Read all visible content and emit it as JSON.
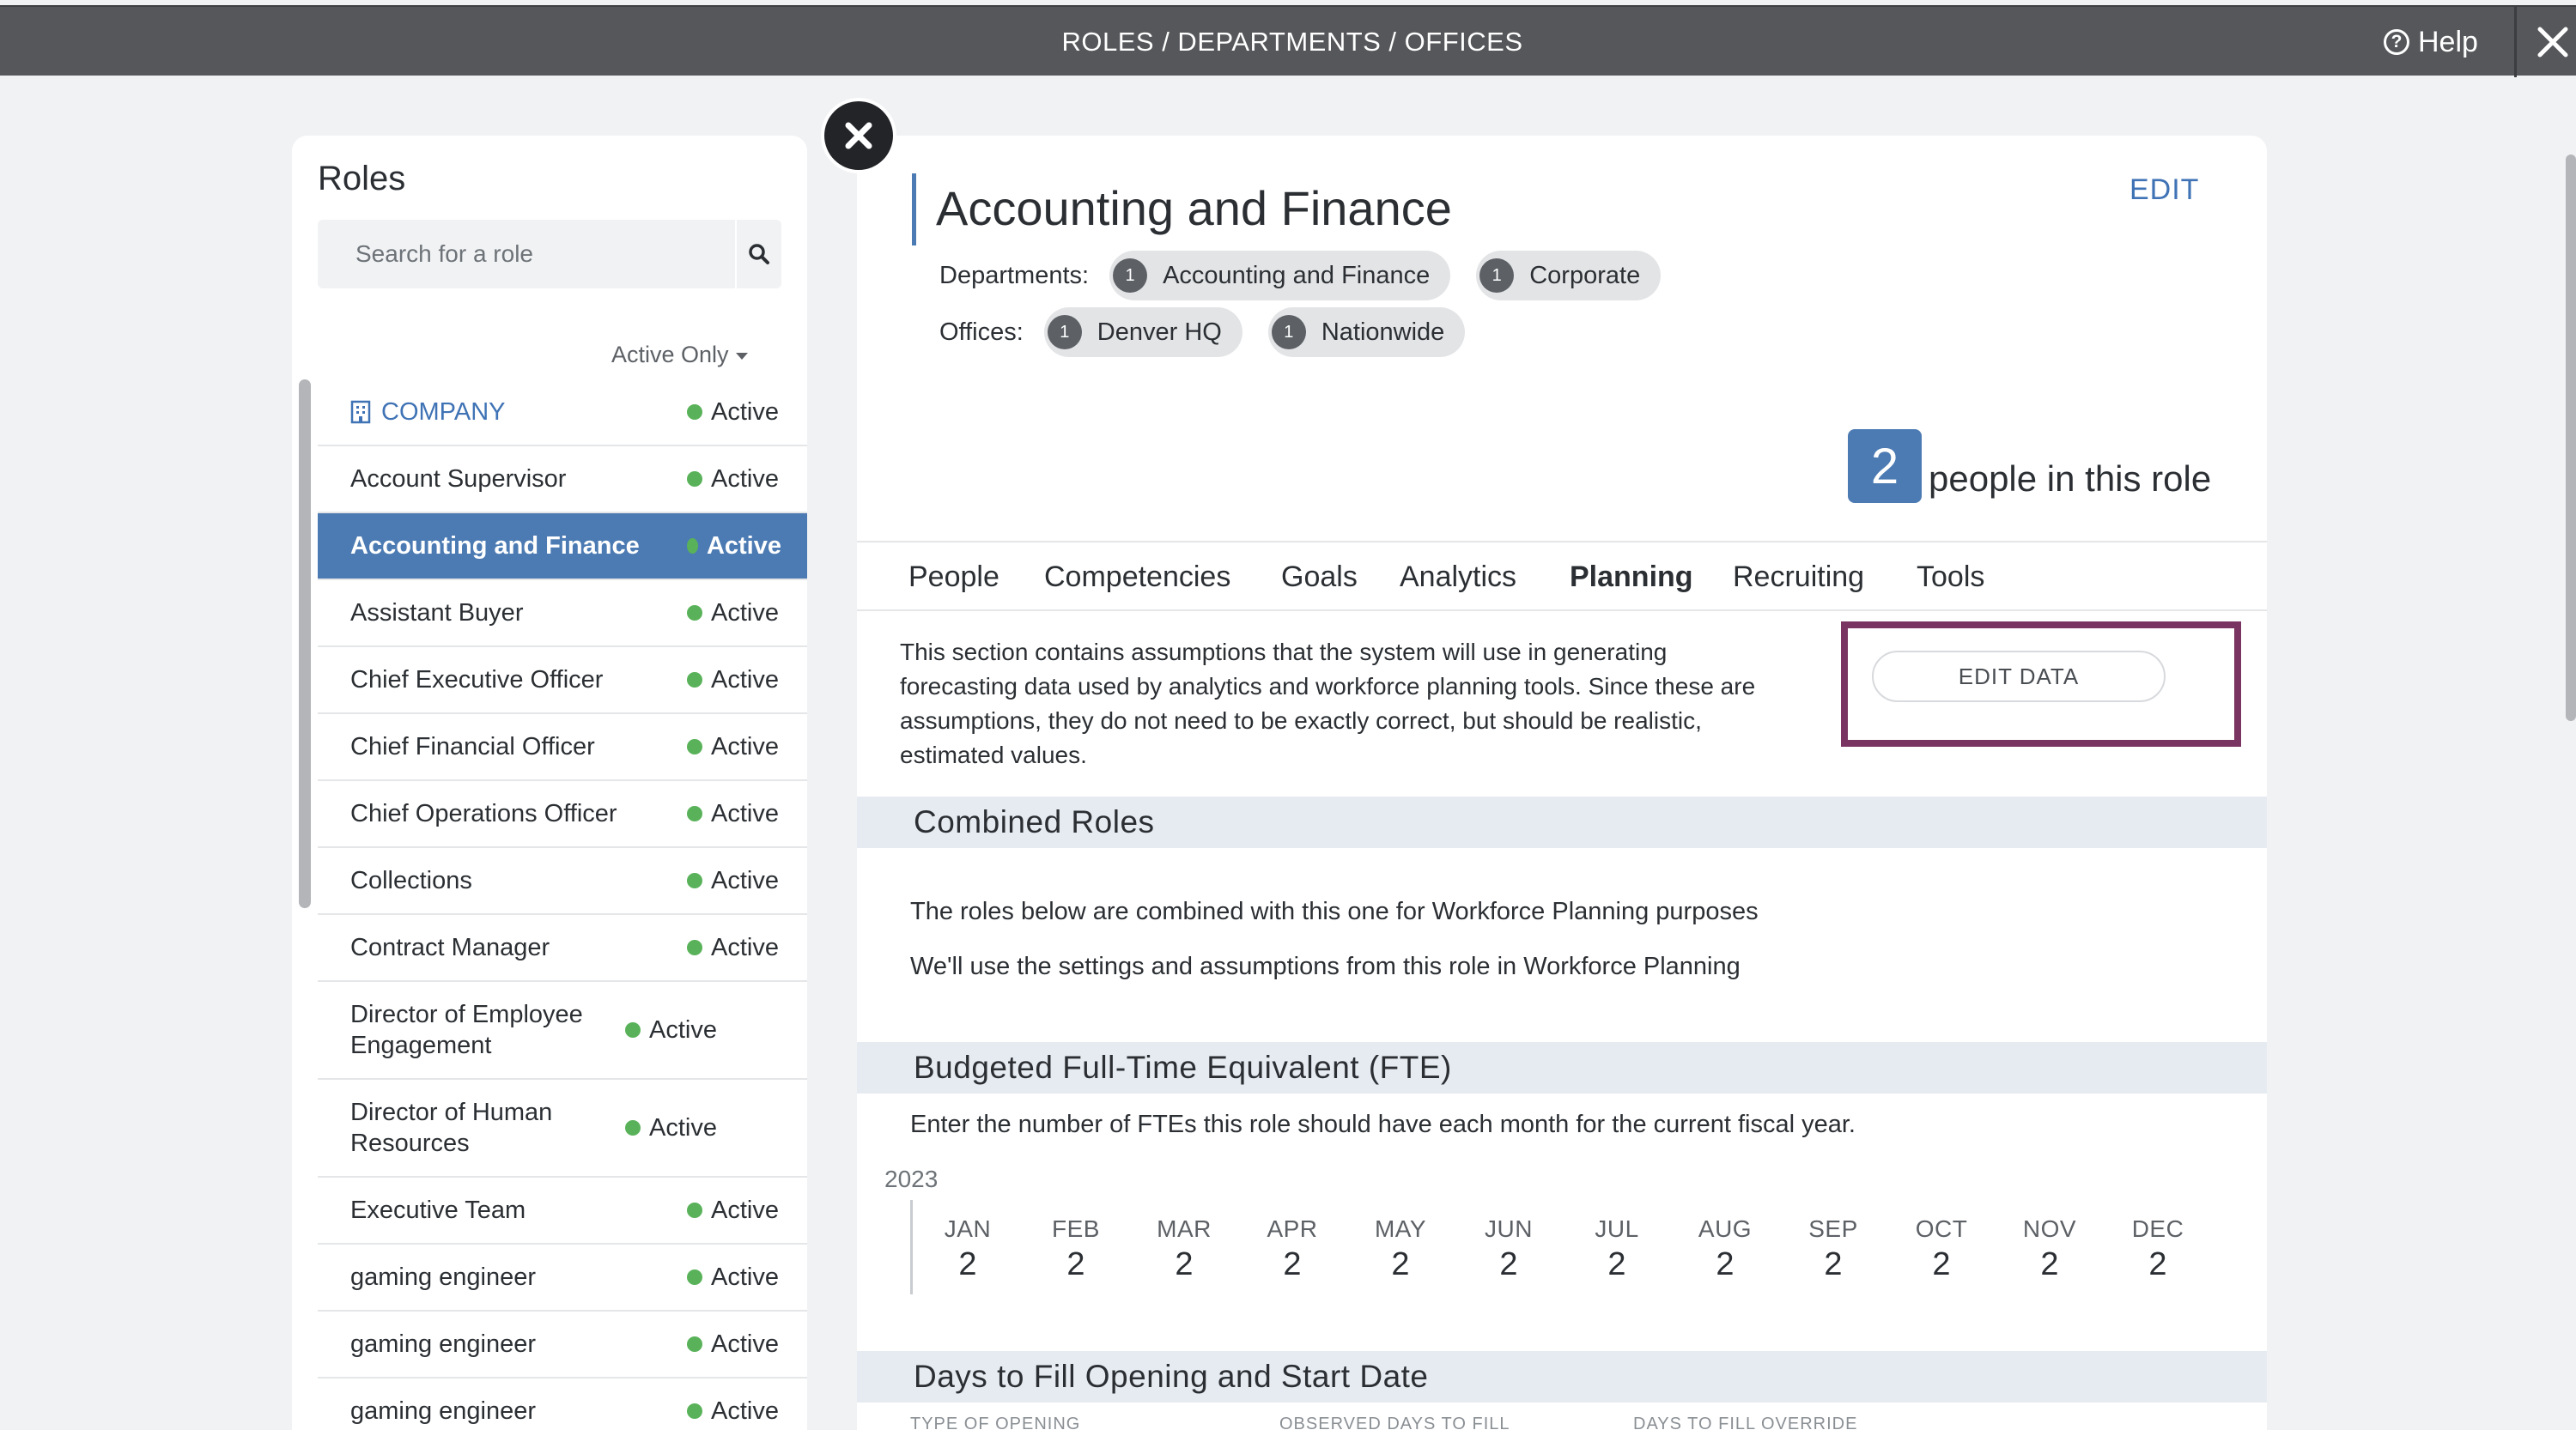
{
  "topbar": {
    "title": "ROLES / DEPARTMENTS / OFFICES",
    "help_label": "Help"
  },
  "sidebar": {
    "title": "Roles",
    "search_placeholder": "Search for a role",
    "filter_label": "Active Only",
    "company": {
      "label": "COMPANY",
      "status": "Active"
    },
    "roles": [
      {
        "name": "Account Supervisor",
        "status": "Active"
      },
      {
        "name": "Accounting and Finance",
        "status": "Active",
        "selected": true
      },
      {
        "name": "Assistant Buyer",
        "status": "Active"
      },
      {
        "name": "Chief Executive Officer",
        "status": "Active"
      },
      {
        "name": "Chief Financial Officer",
        "status": "Active"
      },
      {
        "name": "Chief Operations Officer",
        "status": "Active"
      },
      {
        "name": "Collections",
        "status": "Active"
      },
      {
        "name": "Contract Manager",
        "status": "Active"
      },
      {
        "name": "Director of Employee Engagement",
        "status": "Active"
      },
      {
        "name": "Director of Human Resources",
        "status": "Active"
      },
      {
        "name": "Executive Team",
        "status": "Active"
      },
      {
        "name": "gaming engineer",
        "status": "Active"
      },
      {
        "name": "gaming engineer",
        "status": "Active"
      },
      {
        "name": "gaming engineer",
        "status": "Active"
      }
    ]
  },
  "main": {
    "title": "Accounting and Finance",
    "edit_label": "EDIT",
    "departments_label": "Departments:",
    "departments": [
      {
        "count": "1",
        "name": "Accounting and Finance"
      },
      {
        "count": "1",
        "name": "Corporate"
      }
    ],
    "offices_label": "Offices:",
    "offices": [
      {
        "count": "1",
        "name": "Denver HQ"
      },
      {
        "count": "1",
        "name": "Nationwide"
      }
    ],
    "people_count": "2",
    "people_label": "people in this role",
    "tabs": [
      {
        "label": "People"
      },
      {
        "label": "Competencies"
      },
      {
        "label": "Goals"
      },
      {
        "label": "Analytics"
      },
      {
        "label": "Planning",
        "active": true
      },
      {
        "label": "Recruiting"
      },
      {
        "label": "Tools"
      }
    ],
    "intro_text": "This section contains assumptions that the system will use in generating forecasting data used by analytics and workforce planning tools. Since these are assumptions, they do not need to be exactly correct, but should be realistic, estimated values.",
    "edit_data_label": "EDIT DATA",
    "combined_roles": {
      "heading": "Combined Roles",
      "line1": "The roles below are combined with this one for Workforce Planning purposes",
      "line2": "We'll use the settings and assumptions from this role in Workforce Planning"
    },
    "fte": {
      "heading": "Budgeted Full-Time Equivalent (FTE)",
      "description": "Enter the number of FTEs this role should have each month for the current fiscal year.",
      "year": "2023",
      "months": [
        {
          "name": "JAN",
          "value": "2"
        },
        {
          "name": "FEB",
          "value": "2"
        },
        {
          "name": "MAR",
          "value": "2"
        },
        {
          "name": "APR",
          "value": "2"
        },
        {
          "name": "MAY",
          "value": "2"
        },
        {
          "name": "JUN",
          "value": "2"
        },
        {
          "name": "JUL",
          "value": "2"
        },
        {
          "name": "AUG",
          "value": "2"
        },
        {
          "name": "SEP",
          "value": "2"
        },
        {
          "name": "OCT",
          "value": "2"
        },
        {
          "name": "NOV",
          "value": "2"
        },
        {
          "name": "DEC",
          "value": "2"
        }
      ]
    },
    "days_to_fill": {
      "heading": "Days to Fill Opening and Start Date",
      "columns": [
        "TYPE OF OPENING",
        "OBSERVED DAYS TO FILL",
        "DAYS TO FILL OVERRIDE"
      ]
    }
  },
  "colors": {
    "accent": "#4c7bb3",
    "highlight": "#7a3461",
    "active_status": "#59b259",
    "topbar": "#55575a"
  }
}
